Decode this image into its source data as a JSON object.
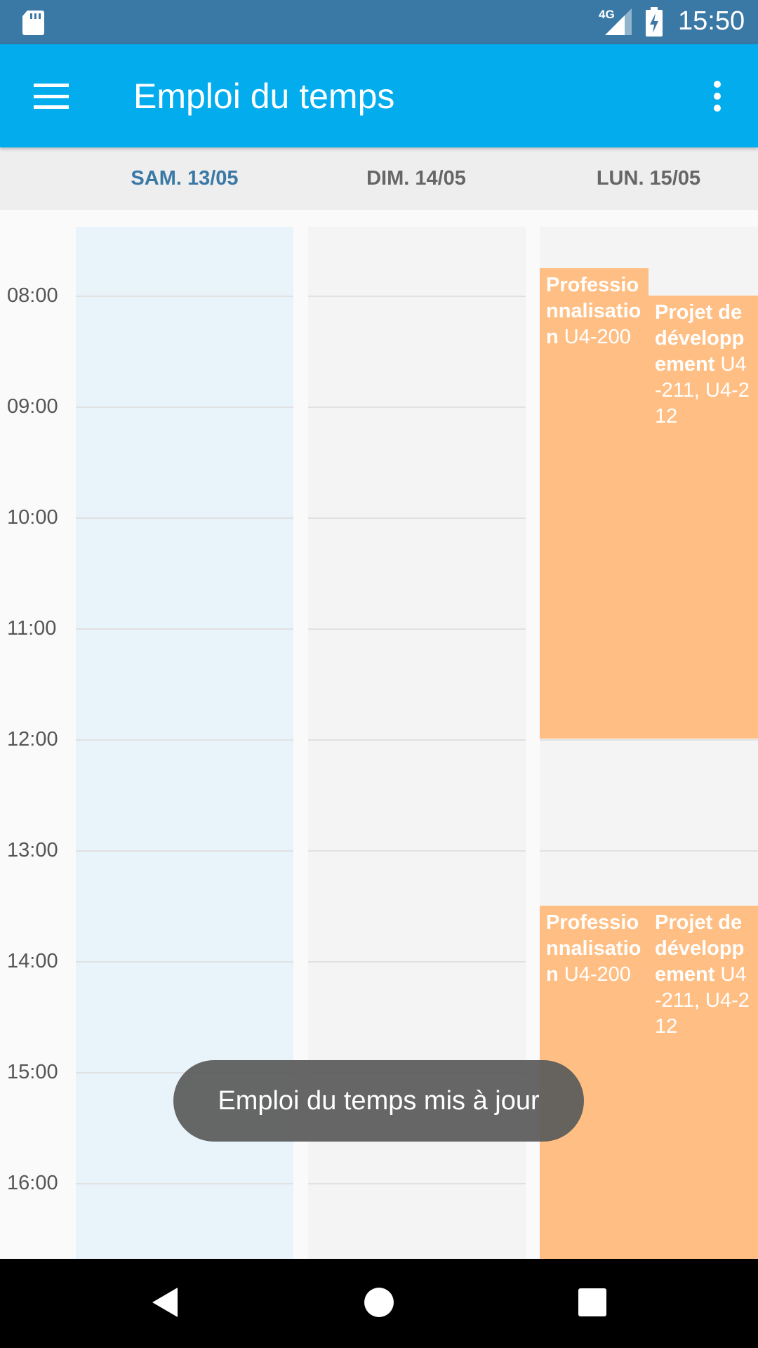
{
  "status_bar": {
    "time": "15:50",
    "network": "4G",
    "icons": [
      "sd-card-icon",
      "signal-icon",
      "battery-charging-icon"
    ]
  },
  "app_bar": {
    "title": "Emploi du temps",
    "menu_icon": "menu-icon",
    "overflow_icon": "more-vert-icon"
  },
  "days": [
    {
      "label": "SAM. 13/05",
      "selected": true
    },
    {
      "label": "DIM. 14/05",
      "selected": false
    },
    {
      "label": "LUN. 15/05",
      "selected": false
    }
  ],
  "hours": [
    "08:00",
    "09:00",
    "10:00",
    "11:00",
    "12:00",
    "13:00",
    "14:00",
    "15:00",
    "16:00"
  ],
  "events": [
    {
      "title": "Professionnalisation",
      "room": "U4-200",
      "day": "LUN. 15/05",
      "start": "07:45",
      "end": "12:00"
    },
    {
      "title": "Projet de développement",
      "room": "U4-211, U4-212",
      "day": "LUN. 15/05",
      "start": "08:00",
      "end": "12:00"
    },
    {
      "title": "Professionnalisation",
      "room": "U4-200",
      "day": "LUN. 15/05",
      "start": "13:30",
      "end": ""
    },
    {
      "title": "Projet de développement",
      "room": "U4-211, U4-212",
      "day": "LUN. 15/05",
      "start": "13:30",
      "end": ""
    }
  ],
  "toast": {
    "message": "Emploi du temps mis à jour"
  },
  "colors": {
    "status_bar": "#3a78a6",
    "app_bar": "#03aded",
    "selected_day": "#3a78a6",
    "event": "#ffbf84",
    "today_column": "#e9f3fa"
  },
  "nav_bar": {
    "icons": [
      "back-icon",
      "home-icon",
      "recents-icon"
    ]
  }
}
